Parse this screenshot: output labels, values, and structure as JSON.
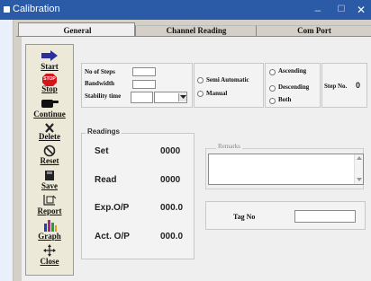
{
  "window": {
    "title": "Calibration",
    "minimize": "–",
    "maximize": "☐",
    "close": "✕"
  },
  "tabs": [
    {
      "label": "General"
    },
    {
      "label": "Channel Reading"
    },
    {
      "label": "Com Port"
    }
  ],
  "toolbar": [
    {
      "label": "Start",
      "icon": "arrow-right-icon"
    },
    {
      "label": "Stop",
      "icon": "stop-sign-icon",
      "badge": "STOP"
    },
    {
      "label": "Continue",
      "icon": "pointing-hand-icon"
    },
    {
      "label": "Delete",
      "icon": "x-icon"
    },
    {
      "label": "Reset",
      "icon": "no-symbol-icon"
    },
    {
      "label": "Save",
      "icon": "floppy-icon"
    },
    {
      "label": "Report",
      "icon": "report-icon"
    },
    {
      "label": "Graph",
      "icon": "bar-graph-icon"
    },
    {
      "label": "Close",
      "icon": "move-arrows-icon"
    }
  ],
  "settings": {
    "steps_label": "No of Steps",
    "steps_value": "",
    "bandwidth_label": "Bandwidth",
    "bandwidth_value": "",
    "stability_label": "Stability time",
    "stability_value": "",
    "stability_unit": ""
  },
  "mode": {
    "semi_label": "Semi Automatic",
    "manual_label": "Manual"
  },
  "direction": {
    "asc_label": "Ascending",
    "desc_label": "Descending",
    "both_label": "Both"
  },
  "step_no": {
    "label": "Step No.",
    "value": "0"
  },
  "readings": {
    "title": "Readings",
    "rows": [
      {
        "label": "Set",
        "value": "0000"
      },
      {
        "label": "Read",
        "value": "0000"
      },
      {
        "label": "Exp.O/P",
        "value": "000.0"
      },
      {
        "label": "Act. O/P",
        "value": "000.0"
      }
    ]
  },
  "remarks": {
    "label": "Remarks",
    "value": ""
  },
  "tag": {
    "label": "Tag No",
    "value": ""
  }
}
